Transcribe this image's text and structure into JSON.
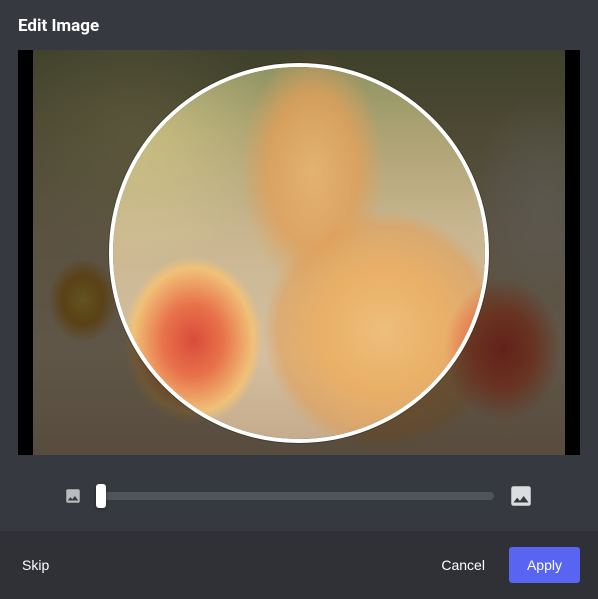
{
  "header": {
    "title": "Edit Image"
  },
  "slider": {
    "value": 0,
    "min": 0,
    "max": 100
  },
  "footer": {
    "skip_label": "Skip",
    "cancel_label": "Cancel",
    "apply_label": "Apply"
  },
  "icons": {
    "zoom_out": "image-icon-small",
    "zoom_in": "image-icon-large"
  },
  "colors": {
    "accent": "#5865f2",
    "background": "#36393f",
    "footer_bg": "#2f3136"
  }
}
